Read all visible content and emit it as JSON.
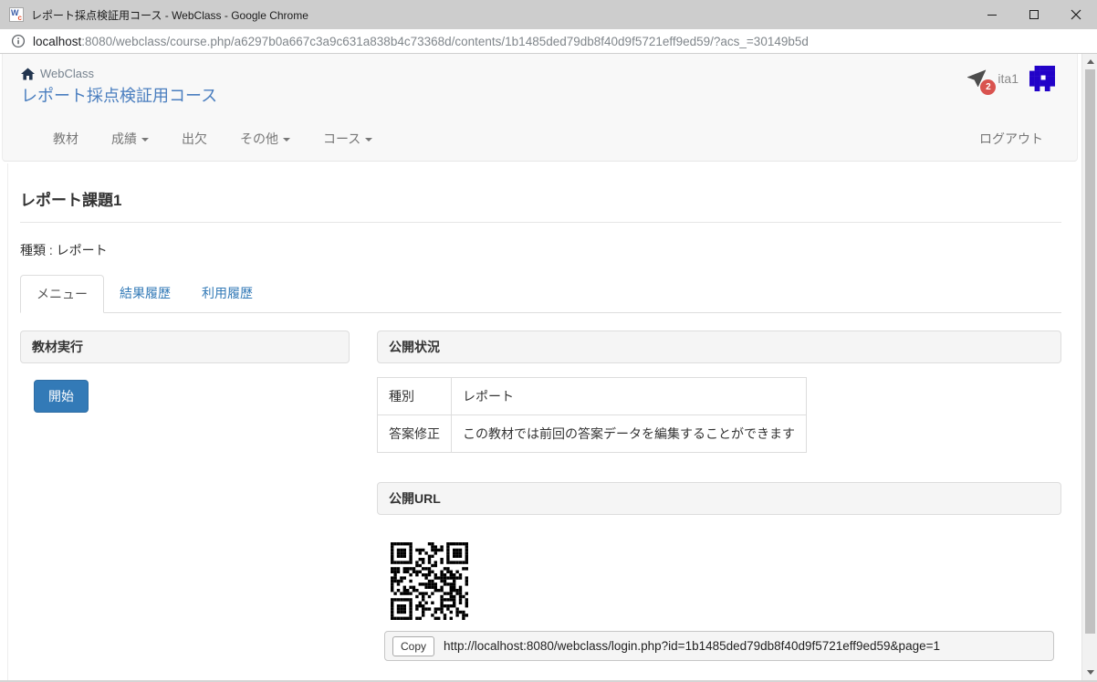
{
  "window": {
    "title": "レポート採点検証用コース - WebClass - Google Chrome"
  },
  "browser": {
    "url_host": "localhost",
    "url_rest": ":8080/webclass/course.php/a6297b0a667c3a9c631a838b4c73368d/contents/1b1485ded79db8f40d9f5721eff9ed59/?acs_=30149b5d"
  },
  "header": {
    "brand": "WebClass",
    "course_title": "レポート採点検証用コース",
    "username": "ita1",
    "notification_count": "2"
  },
  "nav": {
    "items": [
      {
        "label": "教材"
      },
      {
        "label": "成績"
      },
      {
        "label": "出欠"
      },
      {
        "label": "その他"
      },
      {
        "label": "コース"
      }
    ],
    "logout_label": "ログアウト"
  },
  "main": {
    "page_title": "レポート課題1",
    "type_label": "種類 : レポート",
    "active_tab": "メニュー",
    "tabs": [
      {
        "label": "メニュー"
      },
      {
        "label": "結果履歴"
      },
      {
        "label": "利用履歴"
      }
    ],
    "exec_panel": {
      "title": "教材実行",
      "start_button": "開始"
    },
    "status_panel": {
      "title": "公開状況",
      "rows": [
        {
          "label": "種別",
          "value": "レポート"
        },
        {
          "label": "答案修正",
          "value": "この教材では前回の答案データを編集することができます"
        }
      ]
    },
    "url_panel": {
      "title": "公開URL",
      "copy_button": "Copy",
      "public_url": "http://localhost:8080/webclass/login.php?id=1b1485ded79db8f40d9f5721eff9ed59&page=1"
    }
  },
  "icons": {
    "favicon": "WC",
    "home": "house-glyph",
    "message": "paper-plane-glyph",
    "info": "circled-i",
    "qr": "qr-code"
  },
  "colors": {
    "accent": "#337ab7",
    "link": "#337ab7",
    "course_link": "#4a7ebf",
    "badge": "#d9534f",
    "avatar": "#2202c8",
    "titlebar": "#cdcdcd"
  }
}
